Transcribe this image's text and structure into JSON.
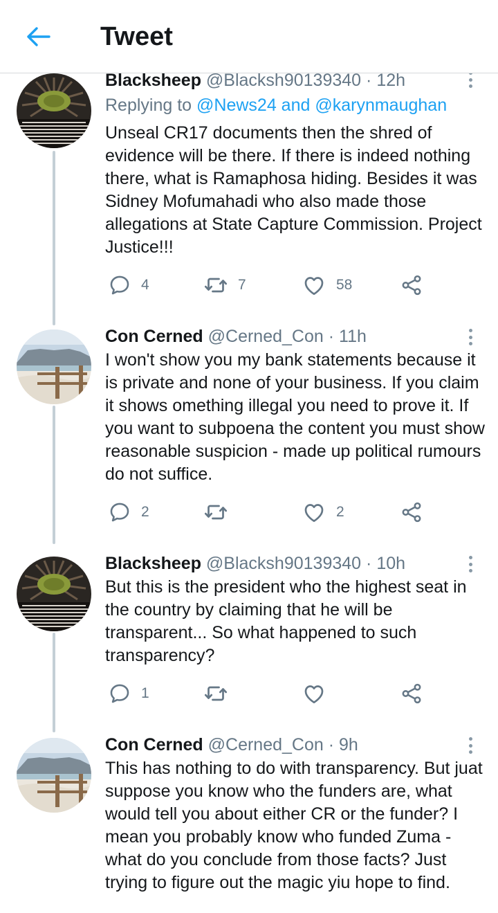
{
  "header": {
    "title": "Tweet",
    "back_icon": "arrow-left-icon"
  },
  "colors": {
    "accent": "#1da1f2",
    "muted": "#657786",
    "thread_line": "#c4cfd6",
    "text": "#14171a"
  },
  "tweets": [
    {
      "name": "Blacksheep",
      "handle": "@Blacksh90139340",
      "dot": "·",
      "time": "12h",
      "replying_prefix": "Replying to",
      "replying_to": "@News24 and @karynmaughan",
      "text": "Unseal CR17 documents then the shred of evidence will be there. If there is indeed nothing there, what is Ramaphosa hiding. Besides it was Sidney Mofumahadi who also made those allegations at State Capture Commission. Project Justice!!!",
      "replies": "4",
      "retweets": "7",
      "likes": "58"
    },
    {
      "name": "Con Cerned",
      "handle": "@Cerned_Con",
      "dot": "·",
      "time": "11h",
      "text": "I won't show you my bank statements because it is private and none of your business. If you claim it shows omething illegal you need to prove it. If you want to subpoena the content you must show reasonable suspicion - made up political rumours do not suffice.",
      "replies": "2",
      "retweets": "",
      "likes": "2"
    },
    {
      "name": "Blacksheep",
      "handle": "@Blacksh90139340",
      "dot": "·",
      "time": "10h",
      "text": "But this is the president who the highest seat in the country by claiming that he will be transparent... So what happened to such transparency?",
      "replies": "1",
      "retweets": "",
      "likes": ""
    },
    {
      "name": "Con Cerned",
      "handle": "@Cerned_Con",
      "dot": "·",
      "time": "9h",
      "text": "This has nothing to do with transparency. But juat suppose you know who the funders are, what would tell you about either CR or the funder? I mean you probably know who funded Zuma - what do you conclude from those facts? Just trying to figure out the magic yiu hope to find.",
      "replies": "",
      "retweets": "",
      "likes": ""
    }
  ]
}
